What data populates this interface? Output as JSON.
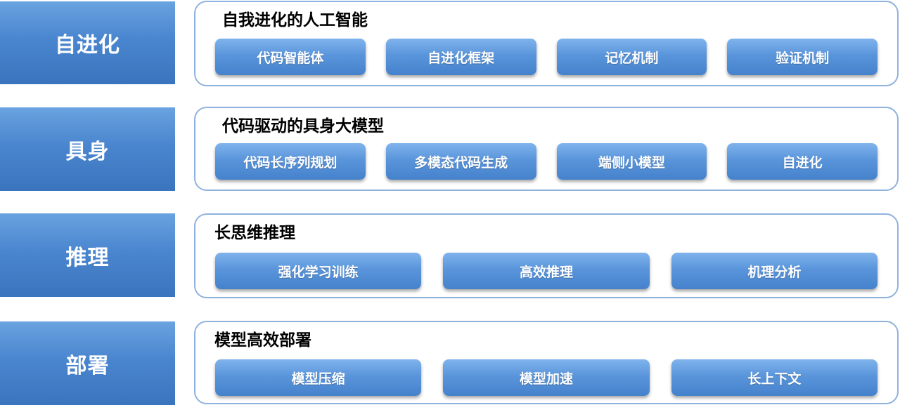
{
  "rows": [
    {
      "label": "自进化",
      "title": "自我进化的人工智能",
      "items": [
        "代码智能体",
        "自进化框架",
        "记忆机制",
        "验证机制"
      ]
    },
    {
      "label": "具身",
      "title": "代码驱动的具身大模型",
      "items": [
        "代码长序列规划",
        "多模态代码生成",
        "端侧小模型",
        "自进化"
      ]
    },
    {
      "label": "推理",
      "title": "长思维推理",
      "items": [
        "强化学习训练",
        "高效推理",
        "机理分析"
      ]
    },
    {
      "label": "部署",
      "title": "模型高效部署",
      "items": [
        "模型压缩",
        "模型加速",
        "长上下文"
      ]
    }
  ],
  "colors": {
    "label_fill": "#4a86cf",
    "chip_fill": "#5a95db",
    "panel_border": "#8fb2dd"
  }
}
